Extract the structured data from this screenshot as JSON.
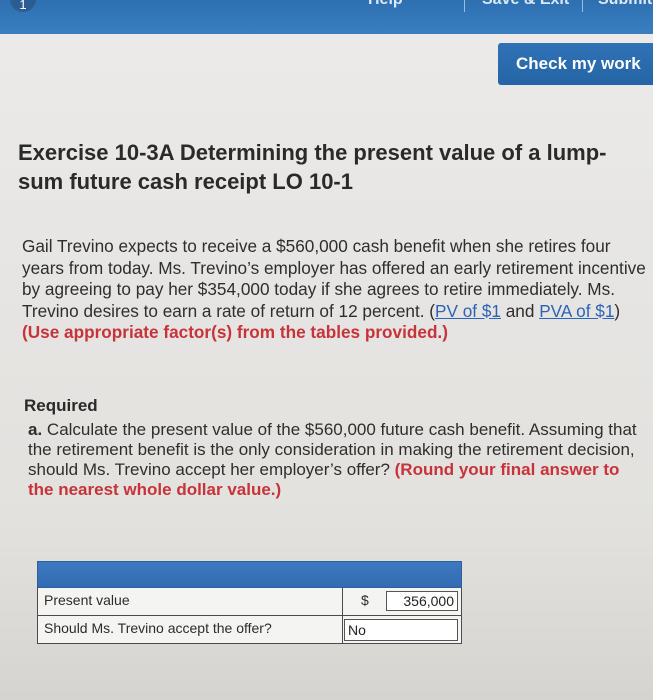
{
  "toolbar": {
    "badge": "1",
    "help_label": "Help",
    "save_label": "Save & Exit",
    "submit_label": "Submit"
  },
  "check_button_label": "Check my work",
  "exercise_title": "Exercise 10-3A Determining the present value of a lump-sum future cash receipt LO 10-1",
  "problem": {
    "text": "Gail Trevino expects to receive a $560,000 cash benefit when she retires four years from today. Ms. Trevino’s employer has offered an early retirement incentive by agreeing to pay her $354,000 today if she agrees to retire immediately. Ms. Trevino desires to earn a rate of return of 12 percent. (",
    "link_pv": "PV of $1",
    "and_text": " and ",
    "link_pva": "PVA of $1",
    "close_paren": ")",
    "note": " (Use appropriate factor(s) from the tables provided.)"
  },
  "required": {
    "heading": "Required",
    "part_label": "a.",
    "text": " Calculate the present value of the $560,000 future cash benefit. Assuming that the retirement benefit is the only consideration in making the retirement decision, should Ms. Trevino accept her employer’s offer? ",
    "note": "(Round your final answer to the nearest whole dollar value.)"
  },
  "answer_table": {
    "rows": [
      {
        "label": "Present value",
        "currency": "$",
        "value": "356,000"
      },
      {
        "label": "Should Ms. Trevino accept the offer?",
        "value": "No"
      }
    ]
  },
  "colors": {
    "toolbar_blue": "#3a7fc0",
    "link_blue": "#2c63b5",
    "note_red": "#c8333a"
  }
}
